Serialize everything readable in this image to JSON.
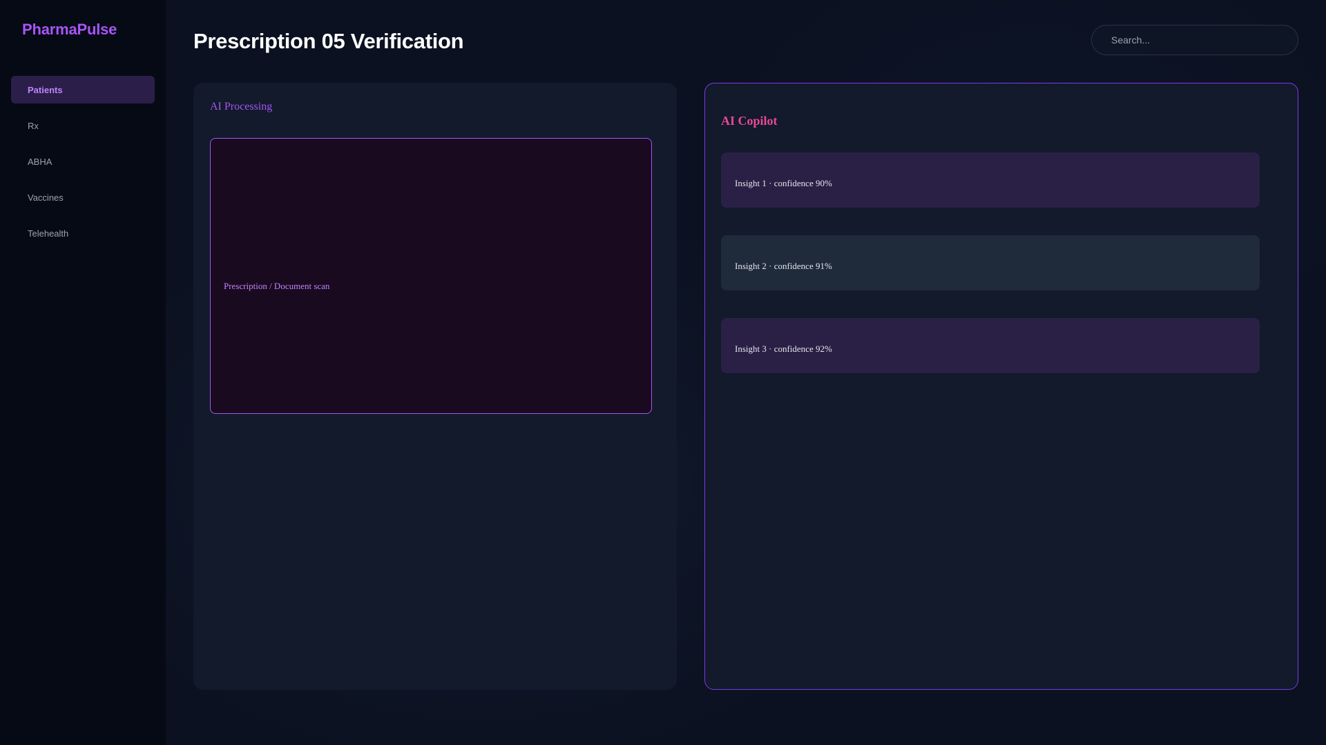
{
  "app": {
    "brand": "PharmaPulse"
  },
  "sidebar": {
    "items": [
      {
        "label": "Patients",
        "active": true
      },
      {
        "label": "Rx",
        "active": false
      },
      {
        "label": "ABHA",
        "active": false
      },
      {
        "label": "Vaccines",
        "active": false
      },
      {
        "label": "Telehealth",
        "active": false
      }
    ]
  },
  "header": {
    "title": "Prescription 05 Verification",
    "search_placeholder": "Search..."
  },
  "main": {
    "left_panel": {
      "heading": "AI Processing",
      "scan_label": "Prescription / Document scan"
    },
    "right_panel": {
      "heading": "AI Copilot",
      "insights": [
        {
          "text": "Insight 1 · confidence 90%"
        },
        {
          "text": "Insight 2 · confidence 91%"
        },
        {
          "text": "Insight 3 · confidence 92%"
        }
      ]
    }
  },
  "colors": {
    "brand": "#a855f7",
    "copilot_heading": "#ec4899",
    "active_nav_bg": "#2b1f4a",
    "panel_border": "#7c3aed"
  }
}
